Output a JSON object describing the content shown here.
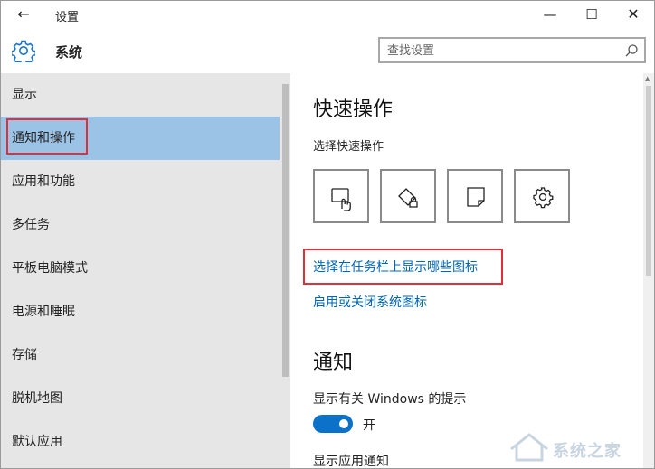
{
  "window": {
    "title": "设置",
    "controls": {
      "back_icon": "back-arrow-icon",
      "minimize_icon": "minimize-icon",
      "maximize_icon": "maximize-icon",
      "close_icon": "close-icon"
    }
  },
  "header": {
    "icon": "gear-icon",
    "title": "系统",
    "search": {
      "placeholder": "查找设置",
      "value": "",
      "icon": "search-icon"
    }
  },
  "sidebar": {
    "selected_index": 1,
    "items": [
      {
        "label": "显示"
      },
      {
        "label": "通知和操作"
      },
      {
        "label": "应用和功能"
      },
      {
        "label": "多任务"
      },
      {
        "label": "平板电脑模式"
      },
      {
        "label": "电源和睡眠"
      },
      {
        "label": "存储"
      },
      {
        "label": "脱机地图"
      },
      {
        "label": "默认应用"
      }
    ]
  },
  "main": {
    "quick_actions": {
      "heading": "快速操作",
      "subheading": "选择快速操作",
      "tiles": [
        {
          "icon": "tablet-mode-icon"
        },
        {
          "icon": "rotation-lock-icon"
        },
        {
          "icon": "note-icon"
        },
        {
          "icon": "settings-gear-icon"
        }
      ],
      "link_taskbar_icons": "选择在任务栏上显示哪些图标",
      "link_system_icons": "启用或关闭系统图标"
    },
    "notifications": {
      "heading": "通知",
      "windows_tips_label": "显示有关 Windows 的提示",
      "windows_tips_toggle": {
        "state": "on",
        "text": "开"
      },
      "app_notifications_label": "显示应用通知"
    }
  },
  "watermark": {
    "text": "系统之家"
  },
  "colors": {
    "sidebar_bg": "#e6e6e6",
    "selected_bg": "#9bc3e6",
    "link": "#0066b4",
    "toggle_on": "#0b71c9",
    "highlight_box": "#e0303a"
  }
}
